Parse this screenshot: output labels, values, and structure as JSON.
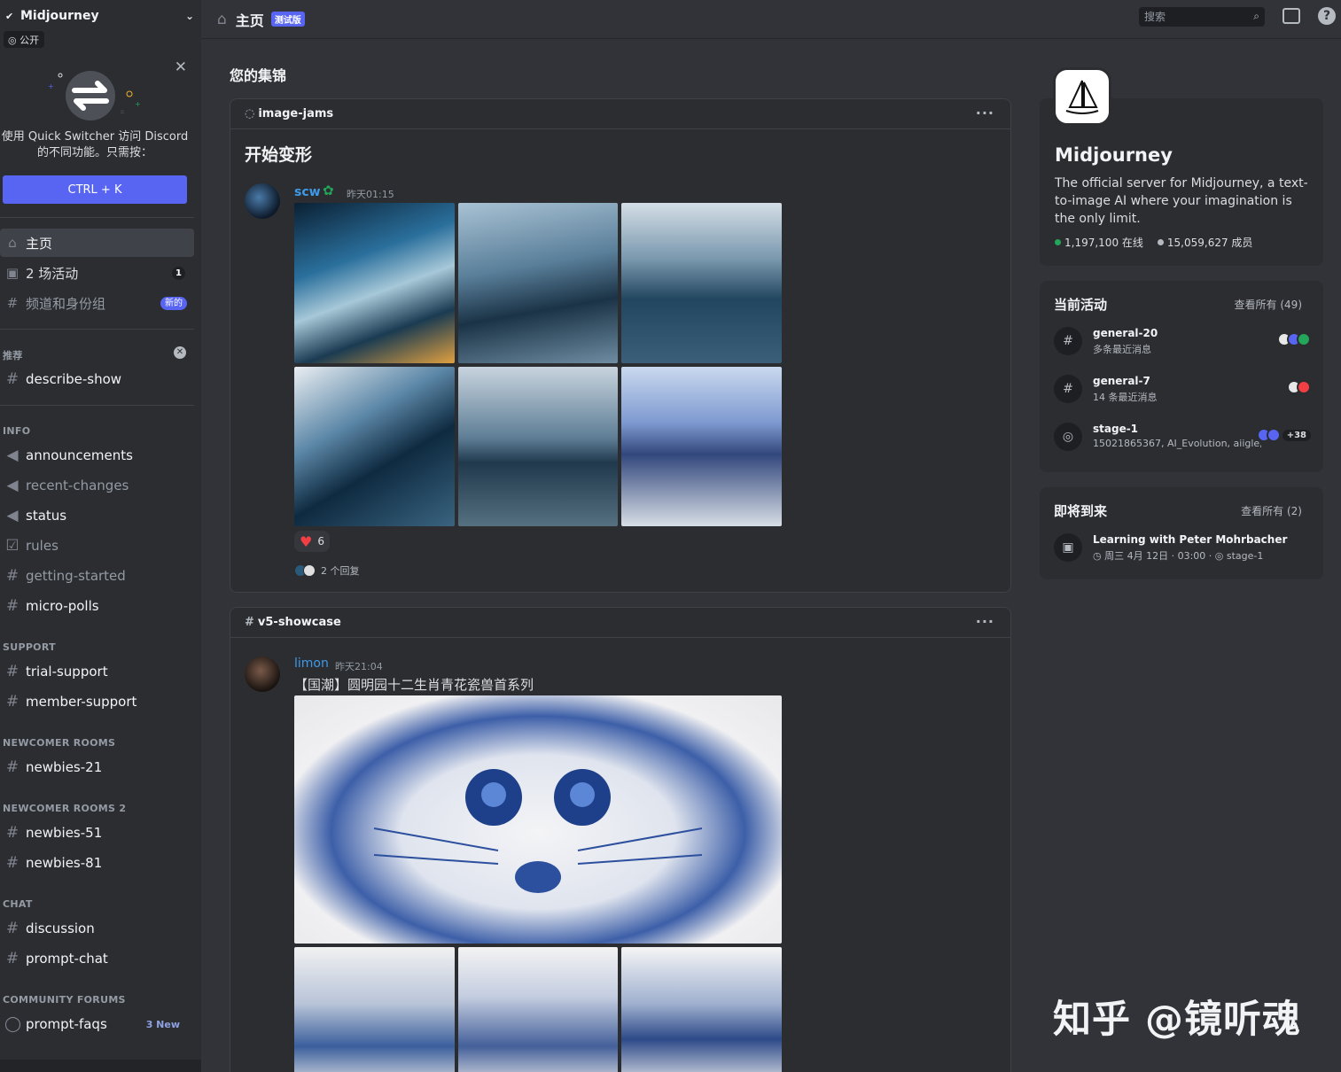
{
  "server": {
    "name": "Midjourney",
    "visibility": "公开"
  },
  "quick_switcher": {
    "text": "使用 Quick Switcher 访问 Discord 的不同功能。只需按：",
    "shortcut": "CTRL + K"
  },
  "nav": [
    {
      "label": "主页",
      "icon": "home-icon"
    },
    {
      "label": "2 场活动",
      "icon": "calendar-icon",
      "badge": "1"
    },
    {
      "label": "频道和身份组",
      "icon": "channels-icon",
      "badge": "新的"
    }
  ],
  "categories": {
    "recommended": "推荐",
    "info": "INFO",
    "support": "SUPPORT",
    "newcomer": "NEWCOMER ROOMS",
    "newcomer2": "NEWCOMER ROOMS 2",
    "chat": "CHAT",
    "forums": "COMMUNITY FORUMS"
  },
  "channels": {
    "recommended": [
      "describe-show"
    ],
    "info": [
      "announcements",
      "recent-changes",
      "status",
      "rules",
      "getting-started",
      "micro-polls"
    ],
    "support": [
      "trial-support",
      "member-support"
    ],
    "newcomer": [
      "newbies-21"
    ],
    "newcomer2": [
      "newbies-51",
      "newbies-81"
    ],
    "chat": [
      "discussion",
      "prompt-chat"
    ],
    "forums": [
      "prompt-faqs"
    ],
    "forums_badge": "3 New"
  },
  "topbar": {
    "title": "主页",
    "beta": "测试版",
    "search_placeholder": "搜索"
  },
  "main": {
    "section_title": "您的集锦",
    "card1": {
      "channel": "image-jams",
      "post_title": "开始变形",
      "user": "scw",
      "time": "昨天01:15",
      "reaction_count": "6",
      "replies": "2 个回复"
    },
    "card2": {
      "channel": "v5-showcase",
      "user": "limon",
      "time": "昨天21:04",
      "message": "【国潮】圆明园十二生肖青花瓷兽首系列"
    }
  },
  "right": {
    "server_name": "Midjourney",
    "description": "The official server for Midjourney, a text-to-image AI where your imagination is the only limit.",
    "online": "1,197,100 在线",
    "members": "15,059,627 成员",
    "activity_title": "当前活动",
    "activity_link": "查看所有 (49)",
    "activities": [
      {
        "name": "general-20",
        "sub": "多条最近消息"
      },
      {
        "name": "general-7",
        "sub": "14 条最近消息"
      },
      {
        "name": "stage-1",
        "sub": "15021865367, AI_Evolution, aiigle, ...",
        "extra": "+38"
      }
    ],
    "upcoming_title": "即将到来",
    "upcoming_link": "查看所有 (2)",
    "event": {
      "name": "Learning with Peter Mohrbacher",
      "when": "周三 4月 12日 · 03:00 ·",
      "where": "stage-1"
    }
  },
  "watermark": "知乎 @镜听魂",
  "colors": {
    "accent": "#5865f2",
    "online": "#23a55a",
    "link_user": "#3e9ae8"
  }
}
